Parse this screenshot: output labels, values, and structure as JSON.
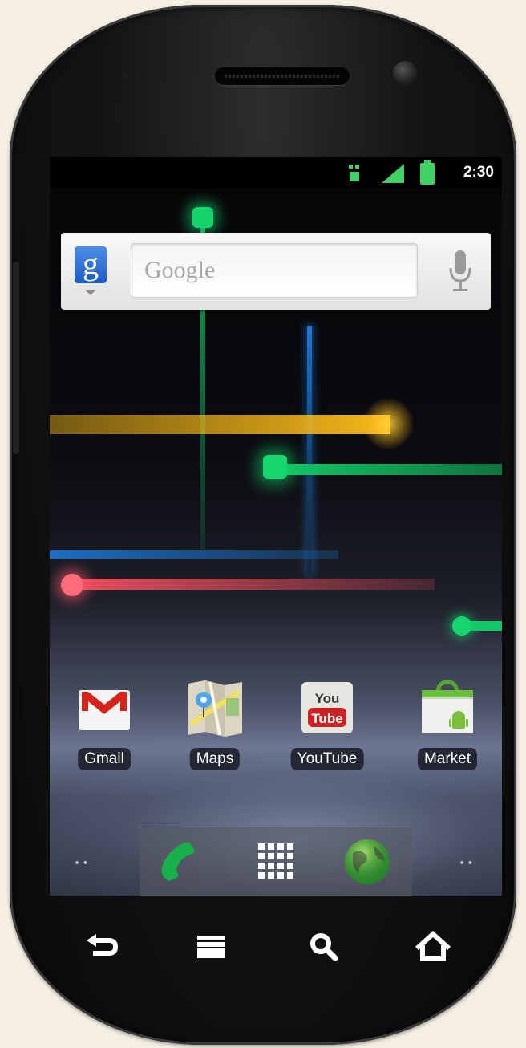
{
  "status_bar": {
    "time": "2:30",
    "icons": [
      "sim-data-icon",
      "signal-icon",
      "battery-icon"
    ]
  },
  "search_widget": {
    "logo_letter": "g",
    "placeholder": "Google",
    "voice_icon": "microphone-icon"
  },
  "apps": [
    {
      "label": "Gmail",
      "icon": "gmail-icon"
    },
    {
      "label": "Maps",
      "icon": "maps-icon"
    },
    {
      "label": "YouTube",
      "icon": "youtube-icon"
    },
    {
      "label": "Market",
      "icon": "market-icon"
    }
  ],
  "youtube_icon_text": {
    "top": "You",
    "bottom": "Tube"
  },
  "dock": {
    "left_dots": "••",
    "right_dots": "••",
    "items": [
      "phone-icon",
      "app-launcher-icon",
      "browser-icon"
    ]
  },
  "nav_buttons": [
    "back-icon",
    "menu-icon",
    "search-icon",
    "home-icon"
  ],
  "colors": {
    "wallpaper_green": "#0fb55e",
    "wallpaper_blue": "#1b78d6",
    "wallpaper_yellow": "#f5b818",
    "wallpaper_red": "#f05060"
  }
}
